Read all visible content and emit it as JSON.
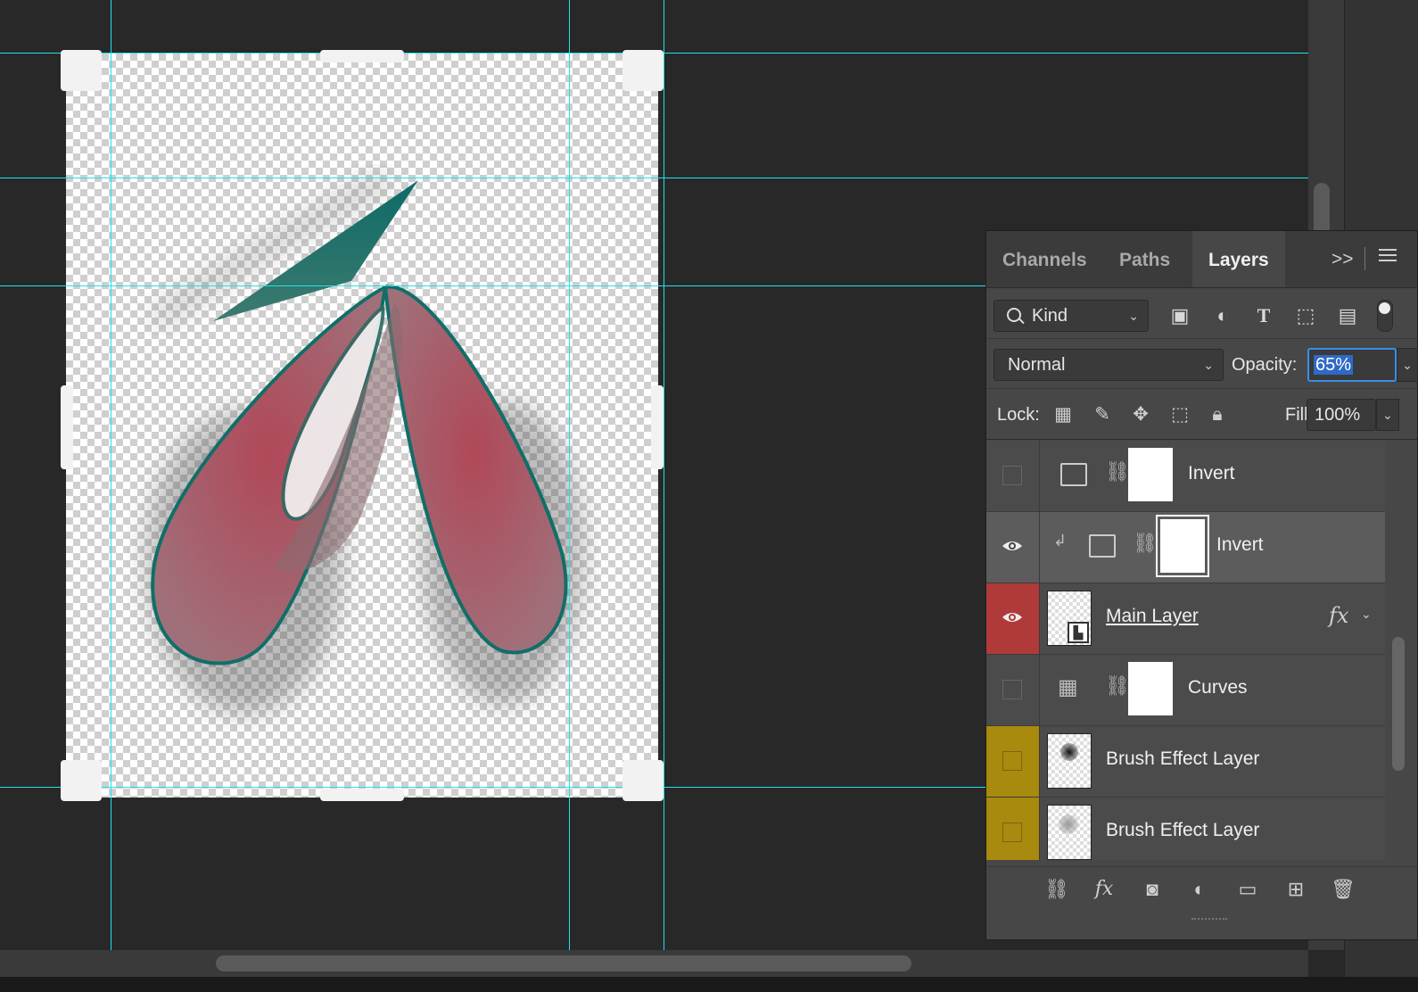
{
  "panel": {
    "tabs": [
      {
        "label": "Channels",
        "active": false
      },
      {
        "label": "Paths",
        "active": false
      },
      {
        "label": "Layers",
        "active": true
      }
    ],
    "more_glyph": ">>",
    "filter": {
      "kind_label": "Kind"
    },
    "blend_mode": "Normal",
    "opacity_label": "Opacity:",
    "opacity_value": "65%",
    "lock_label": "Lock:",
    "fill_label": "Fill:",
    "fill_value": "100%",
    "layers": [
      {
        "name": "Invert",
        "type": "invert-adjustment",
        "visible": false,
        "color_tag": "none",
        "clipped": false,
        "selected": false
      },
      {
        "name": "Invert",
        "type": "invert-adjustment",
        "visible": true,
        "color_tag": "none",
        "clipped": true,
        "selected": true
      },
      {
        "name": "Main Layer",
        "type": "smart-object",
        "visible": true,
        "color_tag": "red",
        "has_fx": true,
        "selected": false
      },
      {
        "name": "Curves",
        "type": "curves-adjustment",
        "visible": false,
        "color_tag": "none",
        "selected": false
      },
      {
        "name": "Brush Effect Layer",
        "type": "pixel",
        "visible": false,
        "color_tag": "yellow",
        "selected": false
      },
      {
        "name": "Brush Effect Layer",
        "type": "pixel",
        "visible": false,
        "color_tag": "yellow",
        "selected": false
      }
    ],
    "fx_label": "fx"
  },
  "colors": {
    "guide": "#1fe3ea",
    "tag_red": "#b03a3a",
    "tag_yellow": "#a88a0e",
    "selection": "#2f69c8",
    "art_fill": "#b6555f",
    "art_stroke": "#0f6f6a"
  },
  "icons": {
    "filter": [
      "image-filter-icon",
      "adjustment-filter-icon",
      "type-filter-icon",
      "shape-filter-icon",
      "smart-object-filter-icon"
    ],
    "lock": [
      "lock-transparent-icon",
      "lock-image-icon",
      "lock-position-icon",
      "lock-artboard-icon",
      "lock-all-icon"
    ],
    "footer": [
      "link-layers-icon",
      "fx-icon",
      "add-mask-icon",
      "new-adjustment-icon",
      "new-group-icon",
      "new-layer-icon",
      "delete-layer-icon"
    ]
  }
}
